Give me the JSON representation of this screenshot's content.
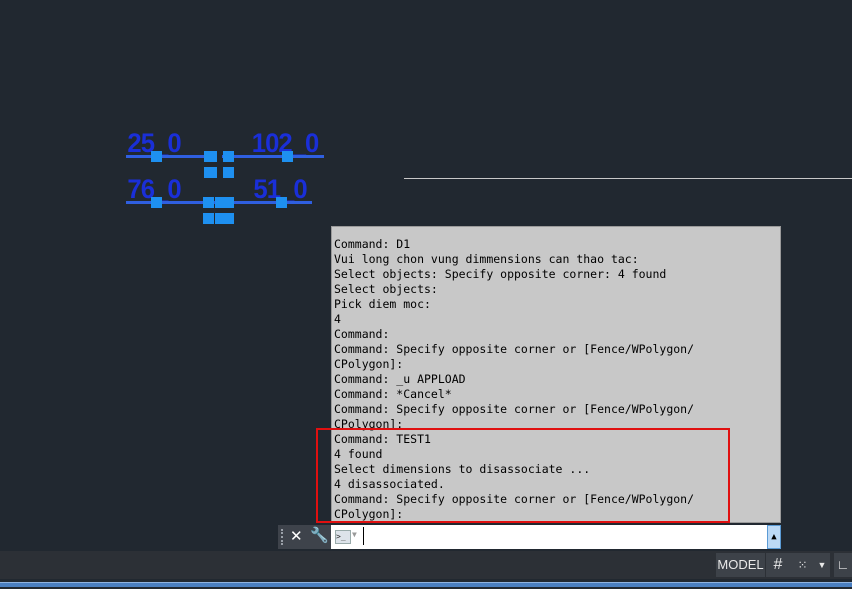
{
  "drawing": {
    "dimensions": [
      {
        "label": "25_0"
      },
      {
        "label": "102_0"
      },
      {
        "label": "76_0"
      },
      {
        "label": "51_0"
      }
    ]
  },
  "command_history": [
    "Command: D1",
    "Vui long chon vung dimmensions can thao tac:",
    "Select objects: Specify opposite corner: 4 found",
    "Select objects:",
    "Pick diem moc:",
    "4",
    "Command:",
    "Command: Specify opposite corner or [Fence/WPolygon/",
    "CPolygon]:",
    "Command: _u APPLOAD",
    "Command: *Cancel*",
    "Command: Specify opposite corner or [Fence/WPolygon/",
    "CPolygon]:",
    "Command: TEST1",
    "4 found",
    "Select dimensions to disassociate ...",
    "4 disassociated.",
    "Command: Specify opposite corner or [Fence/WPolygon/",
    "CPolygon]:"
  ],
  "command_input": {
    "value": ""
  },
  "status_bar": {
    "model_label": "MODEL"
  },
  "colors": {
    "background": "#212830",
    "dimension": "#1a2fd8",
    "grip": "#1e90f0",
    "highlight": "#e01010"
  }
}
